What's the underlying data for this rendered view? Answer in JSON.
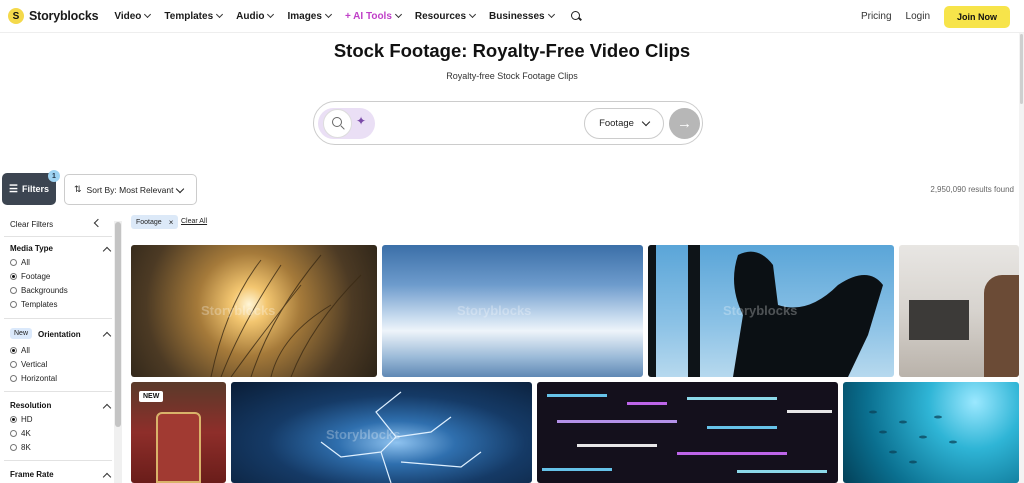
{
  "nav": {
    "brand": "Storyblocks",
    "logo_letter": "S",
    "items": [
      {
        "label": "Video"
      },
      {
        "label": "Templates"
      },
      {
        "label": "Audio"
      },
      {
        "label": "Images"
      },
      {
        "label": "+ AI Tools"
      },
      {
        "label": "Resources"
      },
      {
        "label": "Businesses"
      }
    ],
    "pricing": "Pricing",
    "login": "Login",
    "join": "Join Now"
  },
  "hero": {
    "title": "Stock Footage: Royalty-Free Video Clips",
    "subtitle": "Royalty-free Stock Footage Clips"
  },
  "search": {
    "placeholder": "",
    "type_label": "Footage"
  },
  "toolbar": {
    "filters_label": "Filters",
    "filters_count": "1",
    "sort_label": "Sort By: Most Relevant",
    "results": "2,950,090 results found"
  },
  "sidebar": {
    "clear_filters": "Clear Filters",
    "media_type": {
      "title": "Media Type",
      "options": [
        "All",
        "Footage",
        "Backgrounds",
        "Templates"
      ],
      "selected": "Footage"
    },
    "orientation": {
      "new_tag": "New",
      "title": "Orientation",
      "options": [
        "All",
        "Vertical",
        "Horizontal"
      ],
      "selected": "All"
    },
    "resolution": {
      "title": "Resolution",
      "options": [
        "HD",
        "4K",
        "8K"
      ],
      "selected": "HD"
    },
    "frame_rate": {
      "title": "Frame Rate"
    }
  },
  "chips": {
    "active": "Footage",
    "remove": "×",
    "clear_all": "Clear All"
  },
  "grid": {
    "watermark": "Storyblocks",
    "new_badge": "NEW"
  },
  "colors": {
    "accent": "#f7e44a",
    "ai_tools": "#c040c8",
    "filters_bg": "#3c4551"
  }
}
